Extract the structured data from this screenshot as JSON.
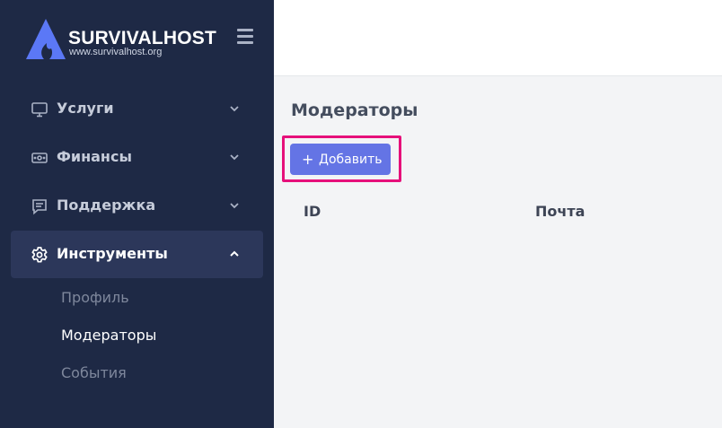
{
  "brand": {
    "name": "SURVIVALHOST",
    "url": "www.survivalhost.org",
    "accent": "#5b78f6"
  },
  "sidebar": {
    "items": [
      {
        "label": "Услуги",
        "icon": "monitor-icon",
        "expanded": false
      },
      {
        "label": "Финансы",
        "icon": "money-icon",
        "expanded": false
      },
      {
        "label": "Поддержка",
        "icon": "chat-icon",
        "expanded": false
      },
      {
        "label": "Инструменты",
        "icon": "gear-icon",
        "expanded": true
      }
    ],
    "subitems": [
      {
        "label": "Профиль"
      },
      {
        "label": "Модераторы",
        "current": true
      },
      {
        "label": "События"
      }
    ]
  },
  "main": {
    "title": "Модераторы",
    "add_button": "Добавить",
    "table": {
      "columns": [
        "ID",
        "Почта"
      ]
    }
  },
  "colors": {
    "sidebar_bg": "#1e2945",
    "active_bg": "#2c375a",
    "button_bg": "#6474e5",
    "highlight": "#e6107a"
  }
}
